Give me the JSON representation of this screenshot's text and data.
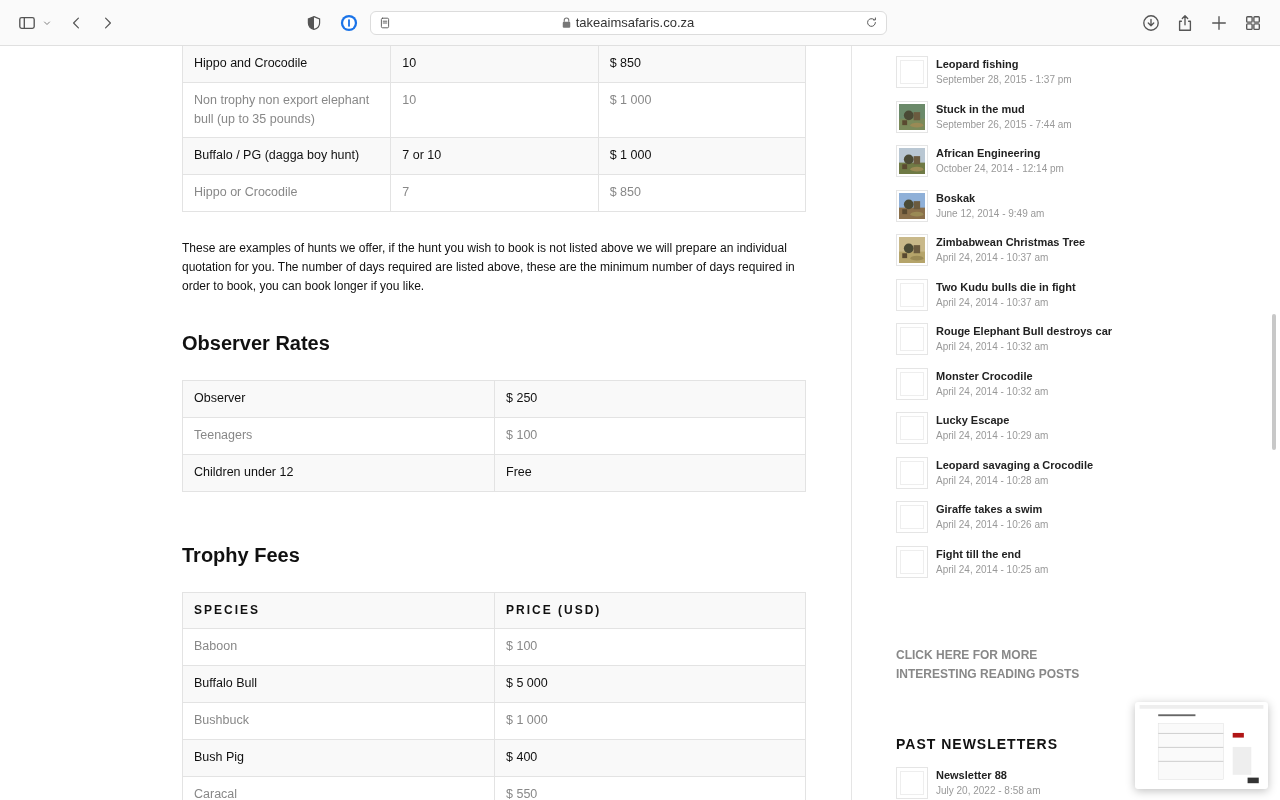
{
  "browser": {
    "url": "takeaimsafaris.co.za"
  },
  "hunt_table": {
    "rows": [
      {
        "cells": [
          "Hippo and Crocodile",
          "10",
          "$ 850"
        ]
      },
      {
        "cells": [
          "Non trophy non export elephant bull (up to 35 pounds)",
          "10",
          "$ 1 000"
        ]
      },
      {
        "cells": [
          "Buffalo / PG (dagga boy hunt)",
          "7 or 10",
          "$ 1 000"
        ]
      },
      {
        "cells": [
          "Hippo or Crocodile",
          "7",
          "$ 850"
        ]
      }
    ]
  },
  "note": "These are examples of hunts we offer, if the hunt you wish to book is not listed above we will prepare an individual quotation for you. The number of days required are listed above, these are the minimum number of days required in order to book, you can book longer if you like.",
  "observer_rates": {
    "heading": "Observer Rates",
    "rows": [
      {
        "cells": [
          "Observer",
          "$ 250"
        ]
      },
      {
        "cells": [
          "Teenagers",
          "$ 100"
        ]
      },
      {
        "cells": [
          "Children under 12",
          "Free"
        ]
      }
    ]
  },
  "trophy_fees": {
    "heading": "Trophy Fees",
    "columns": [
      "SPECIES",
      "PRICE (USD)"
    ],
    "rows": [
      {
        "cells": [
          "Baboon",
          "$ 100"
        ]
      },
      {
        "cells": [
          "Buffalo Bull",
          "$ 5 000"
        ]
      },
      {
        "cells": [
          "Bushbuck",
          "$ 1 000"
        ]
      },
      {
        "cells": [
          "Bush Pig",
          "$ 400"
        ]
      },
      {
        "cells": [
          "Caracal",
          "$ 550"
        ]
      }
    ]
  },
  "sidebar": {
    "posts": [
      {
        "title": "Leopard fishing",
        "date": "September 28, 2015 - 1:37 pm",
        "kind": "empty"
      },
      {
        "title": "Stuck in the mud",
        "date": "September 26, 2015 - 7:44 am",
        "kind": "picture"
      },
      {
        "title": "African Engineering",
        "date": "October 24, 2014 - 12:14 pm",
        "kind": "picture"
      },
      {
        "title": "Boskak",
        "date": "June 12, 2014 - 9:49 am",
        "kind": "picture"
      },
      {
        "title": "Zimbabwean Christmas Tree",
        "date": "April 24, 2014 - 10:37 am",
        "kind": "picture"
      },
      {
        "title": "Two Kudu bulls die in fight",
        "date": "April 24, 2014 - 10:37 am",
        "kind": "empty"
      },
      {
        "title": "Rouge Elephant Bull destroys car",
        "date": "April 24, 2014 - 10:32 am",
        "kind": "empty"
      },
      {
        "title": "Monster Crocodile",
        "date": "April 24, 2014 - 10:32 am",
        "kind": "empty"
      },
      {
        "title": "Lucky Escape",
        "date": "April 24, 2014 - 10:29 am",
        "kind": "empty"
      },
      {
        "title": "Leopard savaging a Crocodile",
        "date": "April 24, 2014 - 10:28 am",
        "kind": "empty"
      },
      {
        "title": "Giraffe takes a swim",
        "date": "April 24, 2014 - 10:26 am",
        "kind": "empty"
      },
      {
        "title": "Fight till the end",
        "date": "April 24, 2014 - 10:25 am",
        "kind": "empty"
      }
    ],
    "more_link": "CLICK HERE FOR MORE INTERESTING READING POSTS",
    "newsletters_heading": "PAST NEWSLETTERS",
    "newsletters": [
      {
        "title": "Newsletter 88",
        "date": "July 20, 2022 - 8:58 am",
        "kind": "empty"
      }
    ]
  }
}
